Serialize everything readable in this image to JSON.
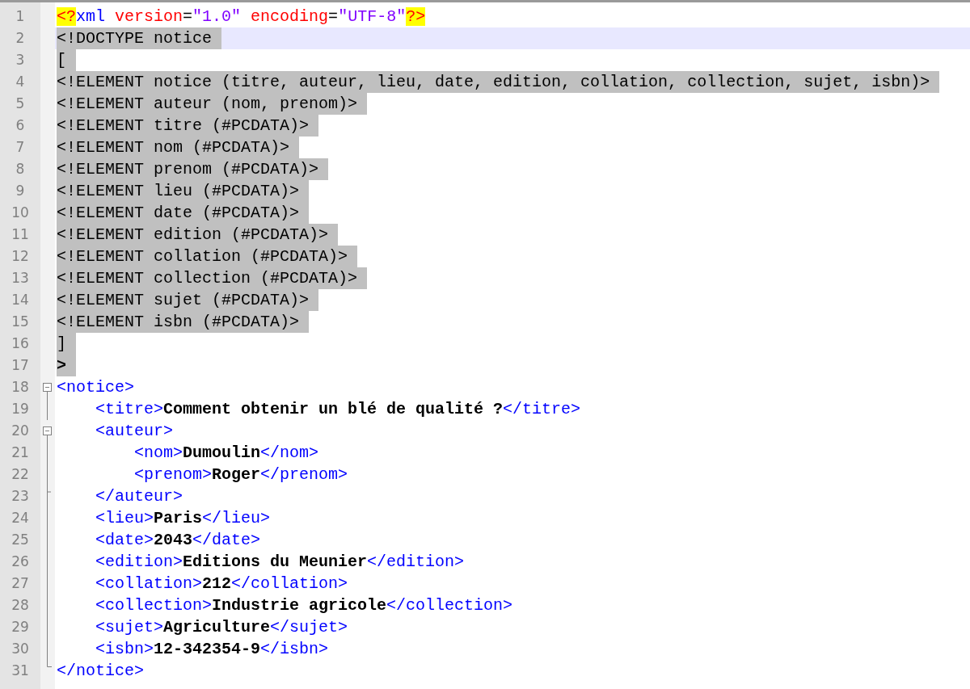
{
  "lines": [
    {
      "number": "1",
      "selected": false,
      "current": false,
      "tokens": [
        {
          "text": "<?",
          "kind": "pi"
        },
        {
          "text": "xml",
          "kind": "name"
        },
        {
          "text": " version",
          "kind": "attr"
        },
        {
          "text": "=",
          "kind": "op"
        },
        {
          "text": "\"1.0\"",
          "kind": "str"
        },
        {
          "text": " encoding",
          "kind": "attr"
        },
        {
          "text": "=",
          "kind": "op"
        },
        {
          "text": "\"UTF-8\"",
          "kind": "str"
        },
        {
          "text": "?>",
          "kind": "pi"
        }
      ]
    },
    {
      "number": "2",
      "selected": true,
      "current": true,
      "tokens": [
        {
          "text": "<!DOCTYPE notice",
          "kind": "plain"
        }
      ]
    },
    {
      "number": "3",
      "selected": true,
      "current": false,
      "tokens": [
        {
          "text": "[",
          "kind": "plain"
        }
      ]
    },
    {
      "number": "4",
      "selected": true,
      "current": false,
      "tokens": [
        {
          "text": "<!ELEMENT notice (titre, auteur, lieu, date, edition, collation, collection, sujet, isbn)>",
          "kind": "plain"
        }
      ]
    },
    {
      "number": "5",
      "selected": true,
      "current": false,
      "tokens": [
        {
          "text": "<!ELEMENT auteur (nom, prenom)>",
          "kind": "plain"
        }
      ]
    },
    {
      "number": "6",
      "selected": true,
      "current": false,
      "tokens": [
        {
          "text": "<!ELEMENT titre (#PCDATA)>",
          "kind": "plain"
        }
      ]
    },
    {
      "number": "7",
      "selected": true,
      "current": false,
      "tokens": [
        {
          "text": "<!ELEMENT nom (#PCDATA)>",
          "kind": "plain"
        }
      ]
    },
    {
      "number": "8",
      "selected": true,
      "current": false,
      "tokens": [
        {
          "text": "<!ELEMENT prenom (#PCDATA)>",
          "kind": "plain"
        }
      ]
    },
    {
      "number": "9",
      "selected": true,
      "current": false,
      "tokens": [
        {
          "text": "<!ELEMENT lieu (#PCDATA)>",
          "kind": "plain"
        }
      ]
    },
    {
      "number": "10",
      "selected": true,
      "current": false,
      "tokens": [
        {
          "text": "<!ELEMENT date (#PCDATA)>",
          "kind": "plain"
        }
      ]
    },
    {
      "number": "11",
      "selected": true,
      "current": false,
      "tokens": [
        {
          "text": "<!ELEMENT edition (#PCDATA)>",
          "kind": "plain"
        }
      ]
    },
    {
      "number": "12",
      "selected": true,
      "current": false,
      "tokens": [
        {
          "text": "<!ELEMENT collation (#PCDATA)>",
          "kind": "plain"
        }
      ]
    },
    {
      "number": "13",
      "selected": true,
      "current": false,
      "tokens": [
        {
          "text": "<!ELEMENT collection (#PCDATA)>",
          "kind": "plain"
        }
      ]
    },
    {
      "number": "14",
      "selected": true,
      "current": false,
      "tokens": [
        {
          "text": "<!ELEMENT sujet (#PCDATA)>",
          "kind": "plain"
        }
      ]
    },
    {
      "number": "15",
      "selected": true,
      "current": false,
      "tokens": [
        {
          "text": "<!ELEMENT isbn (#PCDATA)>",
          "kind": "plain"
        }
      ]
    },
    {
      "number": "16",
      "selected": true,
      "current": false,
      "tokens": [
        {
          "text": "]",
          "kind": "plain"
        }
      ]
    },
    {
      "number": "17",
      "selected": true,
      "current": false,
      "tokens": [
        {
          "text": ">",
          "kind": "bold"
        }
      ]
    },
    {
      "number": "18",
      "selected": false,
      "current": false,
      "fold": {
        "kind": "open"
      },
      "tokens": [
        {
          "text": "<notice>",
          "kind": "tag"
        }
      ],
      "children": [
        {
          "number": "19",
          "selected": false,
          "current": false,
          "fold": {
            "kind": "line"
          },
          "tokens": [
            {
              "text": "<titre>",
              "kind": "tag"
            },
            {
              "text": "Comment obtenir un blé de qualité ?",
              "kind": "content"
            },
            {
              "text": "</titre>",
              "kind": "tag"
            }
          ]
        },
        {
          "number": "20",
          "selected": false,
          "current": false,
          "fold": {
            "kind": "open"
          },
          "tokens": [
            {
              "text": "<auteur>",
              "kind": "tag"
            }
          ],
          "children": [
            {
              "number": "21",
              "selected": false,
              "current": false,
              "fold": {
                "kind": "line"
              },
              "tokens": [
                {
                  "text": "<nom>",
                  "kind": "tag"
                },
                {
                  "text": "Dumoulin",
                  "kind": "content"
                },
                {
                  "text": "</nom>",
                  "kind": "tag"
                }
              ]
            },
            {
              "number": "22",
              "selected": false,
              "current": false,
              "fold": {
                "kind": "line"
              },
              "tokens": [
                {
                  "text": "<prenom>",
                  "kind": "tag"
                },
                {
                  "text": "Roger",
                  "kind": "content"
                },
                {
                  "text": "</prenom>",
                  "kind": "tag"
                }
              ]
            }
          ]
        },
        {
          "number": "23",
          "selected": false,
          "current": false,
          "fold": {
            "kind": "end"
          },
          "tokens": [
            {
              "text": "</auteur>",
              "kind": "tag"
            }
          ]
        },
        {
          "number": "24",
          "selected": false,
          "current": false,
          "fold": {
            "kind": "line"
          },
          "tokens": [
            {
              "text": "<lieu>",
              "kind": "tag"
            },
            {
              "text": "Paris",
              "kind": "content"
            },
            {
              "text": "</lieu>",
              "kind": "tag"
            }
          ]
        },
        {
          "number": "25",
          "selected": false,
          "current": false,
          "fold": {
            "kind": "line"
          },
          "tokens": [
            {
              "text": "<date>",
              "kind": "tag"
            },
            {
              "text": "2043",
              "kind": "content"
            },
            {
              "text": "</date>",
              "kind": "tag"
            }
          ]
        },
        {
          "number": "26",
          "selected": false,
          "current": false,
          "fold": {
            "kind": "line"
          },
          "tokens": [
            {
              "text": "<edition>",
              "kind": "tag"
            },
            {
              "text": "Editions du Meunier",
              "kind": "content"
            },
            {
              "text": "</edition>",
              "kind": "tag"
            }
          ]
        },
        {
          "number": "27",
          "selected": false,
          "current": false,
          "fold": {
            "kind": "line"
          },
          "tokens": [
            {
              "text": "<collation>",
              "kind": "tag"
            },
            {
              "text": "212",
              "kind": "content"
            },
            {
              "text": "</collation>",
              "kind": "tag"
            }
          ]
        },
        {
          "number": "28",
          "selected": false,
          "current": false,
          "fold": {
            "kind": "line"
          },
          "tokens": [
            {
              "text": "<collection>",
              "kind": "tag"
            },
            {
              "text": "Industrie agricole",
              "kind": "content"
            },
            {
              "text": "</collection>",
              "kind": "tag"
            }
          ]
        },
        {
          "number": "29",
          "selected": false,
          "current": false,
          "fold": {
            "kind": "line"
          },
          "tokens": [
            {
              "text": "<sujet>",
              "kind": "tag"
            },
            {
              "text": "Agriculture",
              "kind": "content"
            },
            {
              "text": "</sujet>",
              "kind": "tag"
            }
          ]
        },
        {
          "number": "30",
          "selected": false,
          "current": false,
          "fold": {
            "kind": "line"
          },
          "tokens": [
            {
              "text": "<isbn>",
              "kind": "tag"
            },
            {
              "text": "12-342354-9",
              "kind": "content"
            },
            {
              "text": "</isbn>",
              "kind": "tag"
            }
          ]
        }
      ]
    },
    {
      "number": "31",
      "selected": false,
      "current": false,
      "fold": {
        "kind": "last"
      },
      "tokens": [
        {
          "text": "</notice>",
          "kind": "tag"
        }
      ]
    }
  ]
}
